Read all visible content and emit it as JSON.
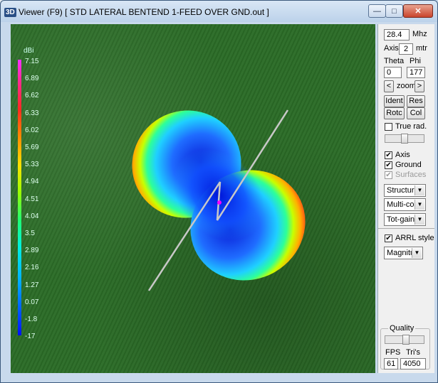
{
  "window": {
    "icon_text": "3D",
    "title": "Viewer (F9)   [  STD LATERAL BENTEND 1-FEED OVER GND.out ]",
    "controls": {
      "minimize": "—",
      "maximize": "□",
      "close": "✕"
    }
  },
  "legend": {
    "unit": "dBi",
    "ticks": [
      "7.15",
      "6.89",
      "6.62",
      "6.33",
      "6.02",
      "5.69",
      "5.33",
      "4.94",
      "4.51",
      "4.04",
      "3.5",
      "2.89",
      "2.16",
      "1.27",
      "0.07",
      "-1.8",
      "-17"
    ],
    "tick_colors": [
      "#ff40ff",
      "#f3309e",
      "#ff2a55",
      "#ff3a10",
      "#ff6a00",
      "#ff9a00",
      "#ffcc00",
      "#e6ff00",
      "#a8ff00",
      "#50ff30",
      "#00ff90",
      "#00ffd8",
      "#00e0ff",
      "#00a8ff",
      "#0070ff",
      "#0040ff",
      "#0010ff"
    ]
  },
  "panel": {
    "frequency": {
      "value": "28.4",
      "unit": "Mhz"
    },
    "axis": {
      "label": "Axis",
      "value": "2",
      "unit": "mtr"
    },
    "theta": {
      "label": "Theta",
      "value": "0"
    },
    "phi": {
      "label": "Phi",
      "value": "177"
    },
    "zoom": {
      "left": "<",
      "label": "zoom",
      "right": ">"
    },
    "buttons": {
      "ident": "Ident",
      "res": "Res",
      "rotc": "Rotc",
      "col": "Col"
    },
    "true_rad": {
      "label": "True rad.",
      "checked": false
    },
    "axis_check": {
      "label": "Axis",
      "checked": true
    },
    "ground_check": {
      "label": "Ground",
      "checked": true
    },
    "surfaces_check": {
      "label": "Surfaces",
      "checked": true,
      "disabled": true
    },
    "dropdowns": {
      "structure": "Structure",
      "color": "Multi-colo",
      "gain": "Tot-gain"
    },
    "arrl": {
      "label": "ARRL style",
      "checked": true
    },
    "magnitude": "Magnitud",
    "quality": {
      "label": "Quality"
    },
    "fps": {
      "label": "FPS",
      "value": "61"
    },
    "tris": {
      "label": "Tri's",
      "value": "4050"
    }
  },
  "colors": {
    "viewport_bg": "#2a6b26",
    "wire": "#c8c8c8",
    "feed": "#ff00ff"
  }
}
